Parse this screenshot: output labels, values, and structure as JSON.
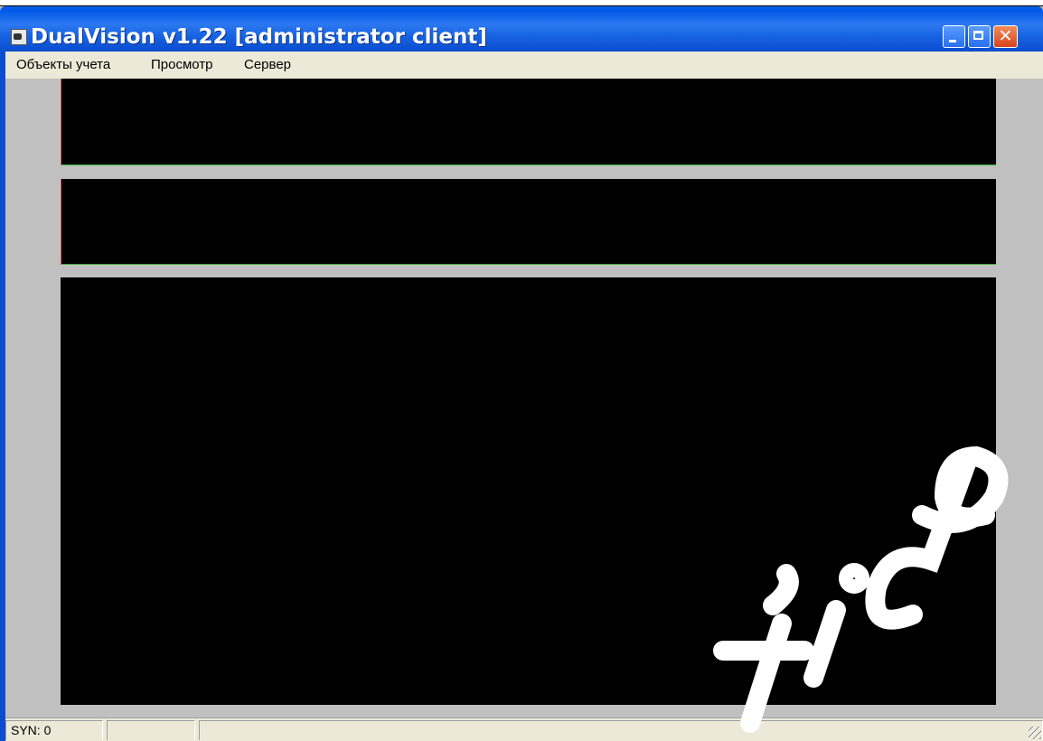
{
  "window": {
    "title": "DualVision v1.22 [administrator client]",
    "icon": "app-camera-icon",
    "controls": {
      "minimize_icon": "minimize-icon",
      "maximize_icon": "maximize-icon",
      "close_icon": "close-icon",
      "close_glyph": "✕"
    }
  },
  "menubar": {
    "items": [
      {
        "label": "Объекты учета"
      },
      {
        "label": "Просмотр"
      },
      {
        "label": "Сервер"
      }
    ]
  },
  "panels": [
    {
      "kind": "video-panel",
      "color": "#000000"
    },
    {
      "kind": "video-panel",
      "color": "#000000"
    },
    {
      "kind": "video-panel",
      "color": "#000000"
    }
  ],
  "statusbar": {
    "cells": [
      {
        "text": "SYN: 0"
      },
      {
        "text": ""
      },
      {
        "text": ""
      }
    ]
  },
  "colors": {
    "titlebar": "#0a5fe0",
    "client_background": "#c0c0c0",
    "panel_border_left": "#e05050",
    "panel_border_bottom": "#3cb03c"
  }
}
